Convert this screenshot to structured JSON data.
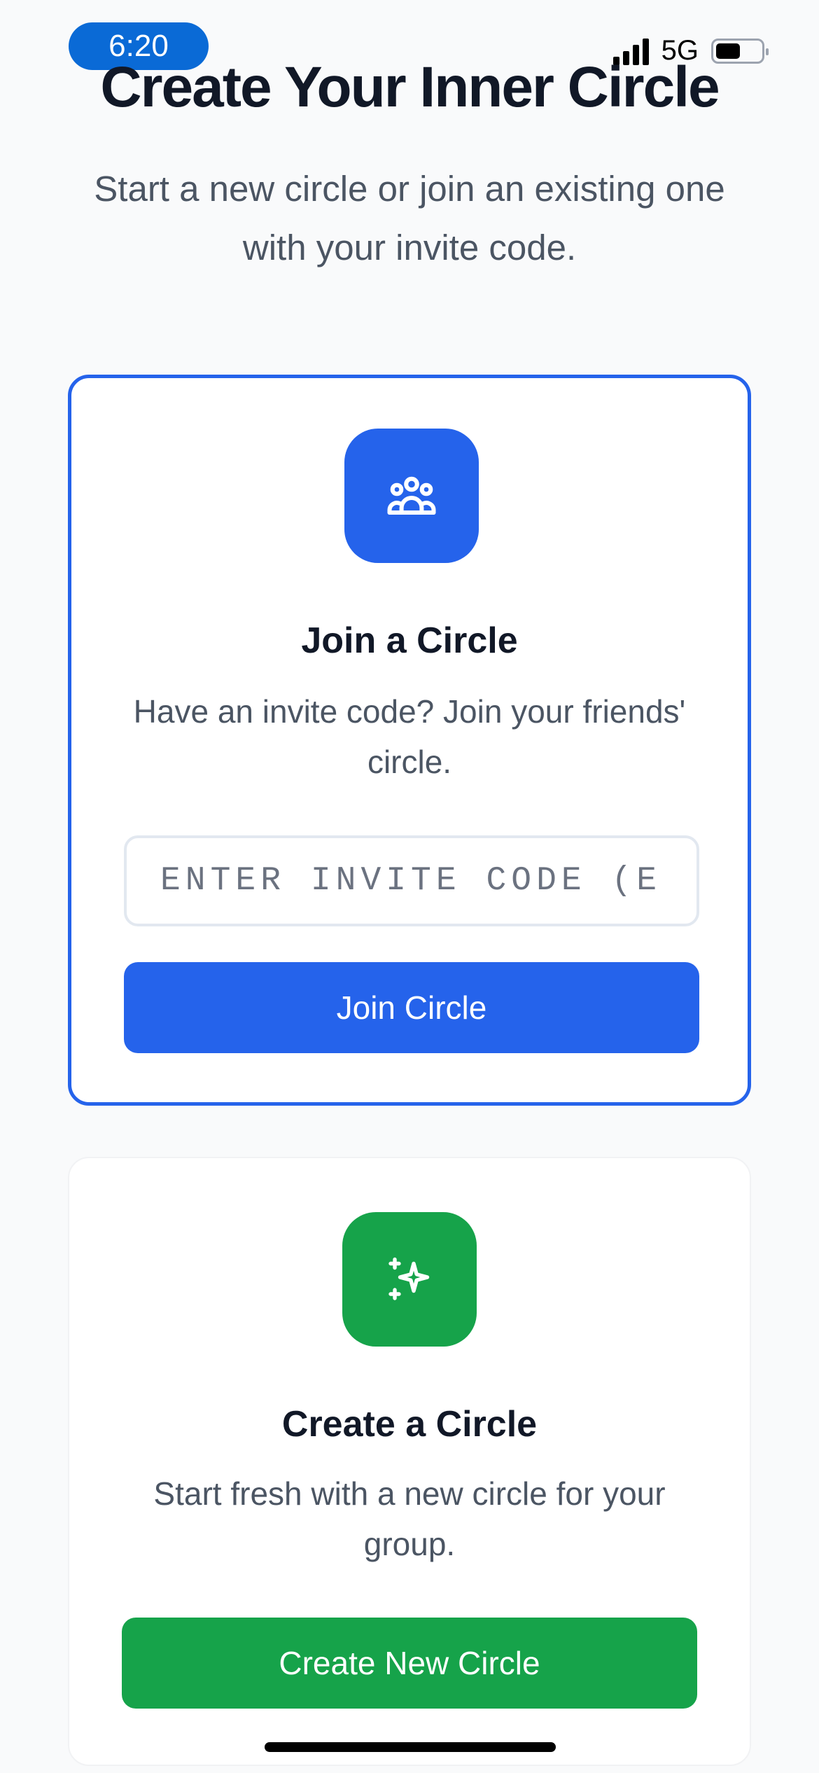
{
  "status_bar": {
    "time": "6:20",
    "network": "5G"
  },
  "header": {
    "title": "Create Your Inner Circle",
    "subtitle": "Start a new circle or join an existing one with your invite code."
  },
  "join_card": {
    "icon": "users-group-icon",
    "title": "Join a Circle",
    "description": "Have an invite code? Join your friends' circle.",
    "input_placeholder": "ENTER INVITE CODE (E.",
    "input_value": "",
    "button_label": "Join Circle",
    "accent_color": "#2563eb"
  },
  "create_card": {
    "icon": "sparkles-icon",
    "title": "Create a Circle",
    "description": "Start fresh with a new circle for your group.",
    "button_label": "Create New Circle",
    "accent_color": "#16a34a"
  }
}
